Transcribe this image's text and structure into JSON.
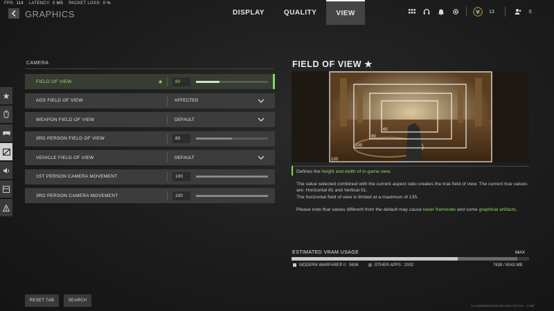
{
  "stats": [
    {
      "label": "FPS:",
      "value": "114"
    },
    {
      "label": "LATENCY:",
      "value": "0 MS"
    },
    {
      "label": "PACKET LOSS:",
      "value": "0 %"
    }
  ],
  "header": {
    "title": "GRAPHICS",
    "tabs": [
      {
        "label": "DISPLAY",
        "active": false
      },
      {
        "label": "QUALITY",
        "active": false
      },
      {
        "label": "VIEW",
        "active": true
      }
    ],
    "icons": [
      "grid-icon",
      "headset-icon",
      "bell-icon",
      "gear-icon"
    ],
    "level": "13",
    "friends": "0"
  },
  "nav": {
    "items": [
      "star-icon",
      "mouse-icon",
      "controller-icon",
      "graphics-icon",
      "audio-icon",
      "interface-icon",
      "account-icon"
    ],
    "active_index": 3
  },
  "section": {
    "label": "CAMERA"
  },
  "settings": [
    {
      "label": "FIELD OF VIEW",
      "type": "slider",
      "value": "80",
      "fill": 0.33,
      "active": true,
      "favorite": true
    },
    {
      "label": "ADS FIELD OF VIEW",
      "type": "dropdown",
      "value": "AFFECTED"
    },
    {
      "label": "WEAPON FIELD OF VIEW",
      "type": "dropdown",
      "value": "DEFAULT"
    },
    {
      "label": "3RD PERSON FIELD OF VIEW",
      "type": "slider",
      "value": "80",
      "fill": 0.5
    },
    {
      "label": "VEHICLE FIELD OF VIEW",
      "type": "dropdown",
      "value": "DEFAULT"
    },
    {
      "label": "1ST PERSON CAMERA MOVEMENT",
      "type": "slider",
      "value": "100",
      "fill": 1.0
    },
    {
      "label": "3RD PERSON CAMERA MOVEMENT",
      "type": "slider",
      "value": "100",
      "fill": 1.0
    }
  ],
  "buttons": {
    "reset": "RESET TAB",
    "search": "SEARCH"
  },
  "info": {
    "title": "FIELD OF VIEW",
    "star": "★",
    "preview_labels": [
      "120",
      "100",
      "80",
      "60"
    ],
    "line1_pre": "Defines the ",
    "line1_link": "height and width of in-game view",
    "line1_post": ".",
    "para2": "The value selected combined with the current aspect ratio creates the true field of view. The current true values are: Horizontal 81 and Vertical 51.",
    "para2b": "The horizontal field of view is limited at a maximum of 135.",
    "para3_pre": "Please note that values different from the default may cause ",
    "para3_link1": "lower framerate",
    "para3_mid": " and some ",
    "para3_link2": "graphical artifacts",
    "para3_post": "."
  },
  "vram": {
    "label": "ESTIMATED VRAM USAGE",
    "max": "MAX",
    "mw_label": "MODERN WARFARE® II : 5636",
    "other_label": "OTHER APPS : 2002",
    "total": "7638 / 8043 MB",
    "mw_fraction": 0.7,
    "other_fraction": 0.25
  },
  "build": "S.3.10480162 [216:135:1444+11] Tmc . CUNI"
}
